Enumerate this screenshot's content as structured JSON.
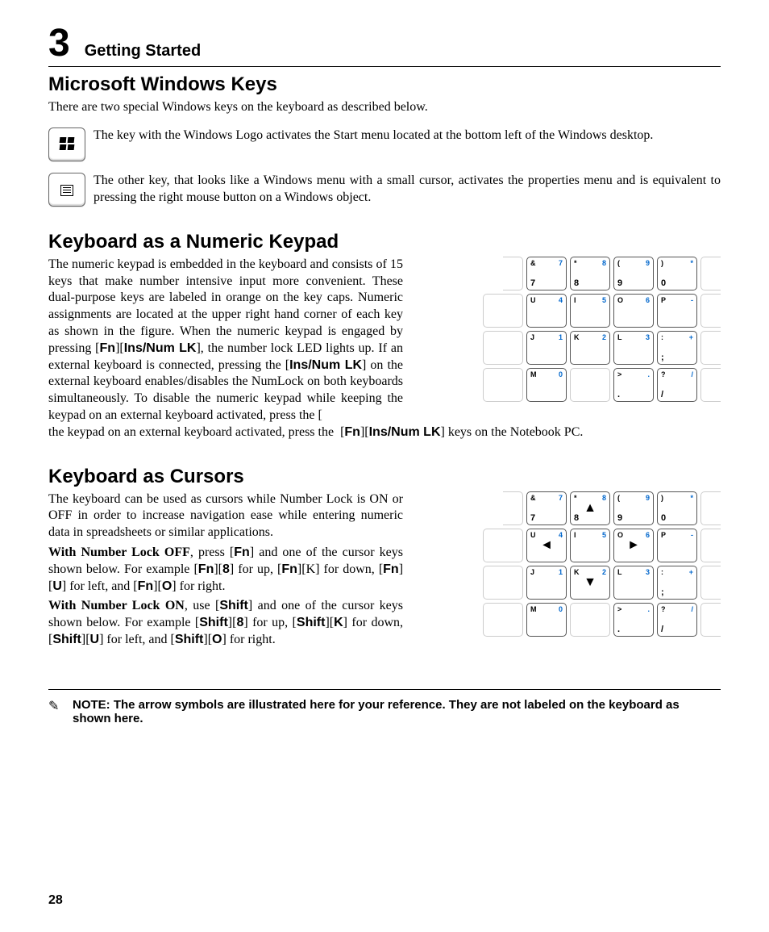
{
  "chapter": {
    "number": "3",
    "title": "Getting Started"
  },
  "section1": {
    "heading": "Microsoft Windows Keys",
    "intro": "There are two special Windows keys on the keyboard as described below.",
    "item1": "The key with the Windows Logo activates the Start menu located at the bottom left of the Windows desktop.",
    "item2": "The other key, that looks like a Windows menu with a small cursor, activates the properties menu and is equivalent to pressing the right mouse button on a Windows object."
  },
  "section2": {
    "heading": "Keyboard as a Numeric Keypad",
    "para_pre": "The numeric keypad is embedded in the keyboard and consists of 15 keys that make number intensive input more convenient. These dual-purpose keys are labeled in orange on the key caps. Numeric assignments are located at the upper right hand corner of each key as shown in the figure. When the numeric keypad is engaged by pressing [",
    "fn": "Fn",
    "mid1": "][",
    "ins": "Ins/Num LK",
    "mid2": "], the number lock LED lights up. If an external keyboard is connected, pressing the [",
    "mid3": "] on the external keyboard enables/disables the NumLock on both keyboards simultaneously. To disable the numeric keypad while keeping the keypad on an external keyboard activated, press the  [",
    "mid4": "][",
    "mid5": "] keys on the Notebook PC."
  },
  "section3": {
    "heading": "Keyboard as Cursors",
    "para1": "The keyboard can be used as cursors while Number Lock is ON or OFF in order to increase navigation ease while entering numeric data in spreadsheets or similar applications.",
    "p2_lead": "With Number Lock OFF",
    "p2_a": ", press [",
    "fn": "Fn",
    "p2_b": "] and one of the cursor keys shown below. For example [",
    "p2_c": "][",
    "k8": "8",
    "p2_d": "] for up, [",
    "p2_e": "][K] for down, [",
    "p2_f": "][",
    "kU": "U",
    "p2_g": "] for left, and [",
    "p2_h": "][",
    "kO": "O",
    "p2_i": "] for right.",
    "p3_lead": "With Number Lock ON",
    "p3_a": ", use [",
    "shift": "Shift",
    "p3_b": "] and one of the cursor keys shown below. For example [",
    "p3_c": "][",
    "p3_d": "] for up, [",
    "p3_e": "][",
    "kK": "K",
    "p3_f": "] for down, [",
    "p3_g": "][",
    "p3_h": "] for left, and [",
    "p3_i": "][",
    "p3_j": "] for right."
  },
  "note": "NOTE: The arrow symbols are illustrated here for your reference. They are not labeled on the keyboard as shown here.",
  "page_number": "28",
  "keypad1": {
    "rows": [
      [
        {
          "blank": true,
          "half": "R"
        },
        {
          "sym": "&",
          "blue": "7",
          "main": "7"
        },
        {
          "sym": "*",
          "blue": "8",
          "main": "8"
        },
        {
          "sym": "(",
          "blue": "9",
          "main": "9"
        },
        {
          "sym": ")",
          "blue": "*",
          "main": "0"
        },
        {
          "blank": true,
          "half": "L"
        }
      ],
      [
        {
          "blank": true
        },
        {
          "sym": "U",
          "blue": "4",
          "main": ""
        },
        {
          "sym": "I",
          "blue": "5",
          "main": ""
        },
        {
          "sym": "O",
          "blue": "6",
          "main": ""
        },
        {
          "sym": "P",
          "blue": "-",
          "main": ""
        },
        {
          "blank": true,
          "half": "L"
        }
      ],
      [
        {
          "blank": true
        },
        {
          "sym": "J",
          "blue": "1",
          "main": ""
        },
        {
          "sym": "K",
          "blue": "2",
          "main": ""
        },
        {
          "sym": "L",
          "blue": "3",
          "main": ""
        },
        {
          "sym": ":",
          "blue": "+",
          "main": ";"
        },
        {
          "blank": true,
          "half": "L"
        }
      ],
      [
        {
          "blank": true
        },
        {
          "sym": "M",
          "blue": "0",
          "main": ""
        },
        {
          "blank": true
        },
        {
          "sym": ">",
          "blue": ".",
          "main": "."
        },
        {
          "sym": "?",
          "blue": "/",
          "main": "/"
        },
        {
          "blank": true,
          "half": "L"
        }
      ]
    ]
  },
  "keypad2": {
    "rows": [
      [
        {
          "blank": true,
          "half": "R"
        },
        {
          "sym": "&",
          "blue": "7",
          "main": "7"
        },
        {
          "sym": "*",
          "blue": "8",
          "main": "8",
          "arrow": "▲"
        },
        {
          "sym": "(",
          "blue": "9",
          "main": "9"
        },
        {
          "sym": ")",
          "blue": "*",
          "main": "0"
        },
        {
          "blank": true,
          "half": "L"
        }
      ],
      [
        {
          "blank": true
        },
        {
          "sym": "U",
          "blue": "4",
          "main": "",
          "arrow": "◄"
        },
        {
          "sym": "I",
          "blue": "5",
          "main": ""
        },
        {
          "sym": "O",
          "blue": "6",
          "main": "",
          "arrow": "►"
        },
        {
          "sym": "P",
          "blue": "-",
          "main": ""
        },
        {
          "blank": true,
          "half": "L"
        }
      ],
      [
        {
          "blank": true
        },
        {
          "sym": "J",
          "blue": "1",
          "main": ""
        },
        {
          "sym": "K",
          "blue": "2",
          "main": "",
          "arrow": "▼"
        },
        {
          "sym": "L",
          "blue": "3",
          "main": ""
        },
        {
          "sym": ":",
          "blue": "+",
          "main": ";"
        },
        {
          "blank": true,
          "half": "L"
        }
      ],
      [
        {
          "blank": true
        },
        {
          "sym": "M",
          "blue": "0",
          "main": ""
        },
        {
          "blank": true
        },
        {
          "sym": ">",
          "blue": ".",
          "main": "."
        },
        {
          "sym": "?",
          "blue": "/",
          "main": "/"
        },
        {
          "blank": true,
          "half": "L"
        }
      ]
    ]
  }
}
